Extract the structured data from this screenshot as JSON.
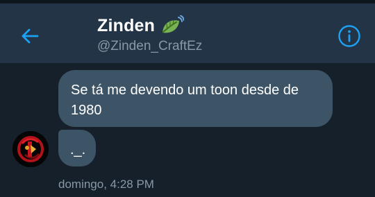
{
  "header": {
    "name": "Zinden",
    "handle": "@Zinden_CraftEz",
    "back_icon": "arrow-left-icon",
    "emoji_icon": "leaf-fluttering-in-wind",
    "info_icon": "info-icon"
  },
  "messages": [
    {
      "text": "Se tá me devendo um toon desde de 1980"
    },
    {
      "text": "._."
    }
  ],
  "timestamp": "domingo, 4:28 PM",
  "colors": {
    "background": "#15202b",
    "header": "#243447",
    "bubble": "#3d5466",
    "accent": "#1da1f2",
    "muted": "#8899a6"
  }
}
